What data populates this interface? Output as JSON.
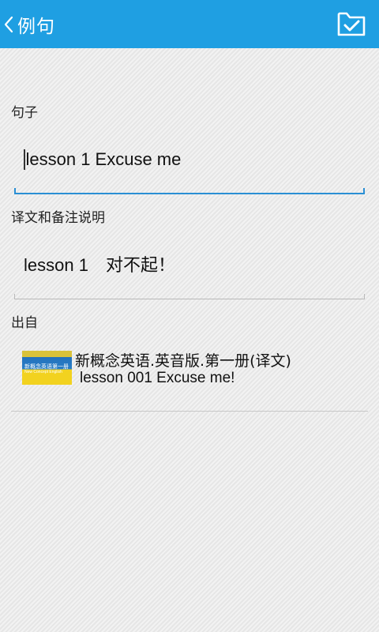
{
  "header": {
    "title": "例句",
    "back_icon": "chevron-left-icon",
    "save_icon": "folder-check-icon"
  },
  "sentence": {
    "label": "句子",
    "value": "lesson 1 Excuse me"
  },
  "translation": {
    "label": "译文和备注说明",
    "value": "lesson 1　对不起！"
  },
  "source": {
    "label": "出自",
    "book_title": "新概念英语.英音版.第一册(译文)",
    "lesson": "lesson 001 Excuse me!",
    "thumb_text_cn": "新概念英语第一册",
    "thumb_text_en": "New Concept English"
  },
  "colors": {
    "accent": "#1f9fe2",
    "field_active_line": "#2a8fd4"
  }
}
